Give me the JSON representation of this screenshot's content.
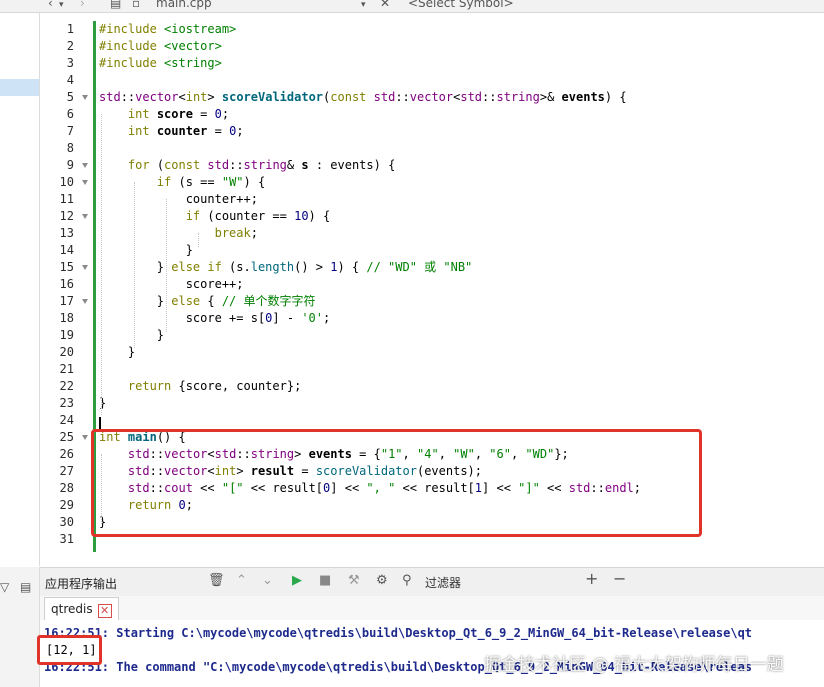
{
  "toolbar": {
    "file_name": "main.cpp",
    "symbol_select": "<Select Symbol>"
  },
  "editor": {
    "line_numbers": [
      "1",
      "2",
      "3",
      "4",
      "5",
      "6",
      "7",
      "8",
      "9",
      "10",
      "11",
      "12",
      "13",
      "14",
      "15",
      "16",
      "17",
      "18",
      "19",
      "20",
      "21",
      "22",
      "23",
      "24",
      "25",
      "26",
      "27",
      "28",
      "29",
      "30",
      "31"
    ],
    "lines": [
      [
        {
          "t": "#include ",
          "c": "kw"
        },
        {
          "t": "<iostream>",
          "c": "st"
        }
      ],
      [
        {
          "t": "#include ",
          "c": "kw"
        },
        {
          "t": "<vector>",
          "c": "st"
        }
      ],
      [
        {
          "t": "#include ",
          "c": "kw"
        },
        {
          "t": "<string>",
          "c": "st"
        }
      ],
      [],
      [
        {
          "t": "std",
          "c": "ty"
        },
        {
          "t": "::",
          "c": ""
        },
        {
          "t": "vector",
          "c": "ty"
        },
        {
          "t": "<",
          "c": ""
        },
        {
          "t": "int",
          "c": "kw"
        },
        {
          "t": "> ",
          "c": ""
        },
        {
          "t": "scoreValidator",
          "c": "fn b"
        },
        {
          "t": "(",
          "c": ""
        },
        {
          "t": "const ",
          "c": "kw"
        },
        {
          "t": "std",
          "c": "ty"
        },
        {
          "t": "::",
          "c": ""
        },
        {
          "t": "vector",
          "c": "ty"
        },
        {
          "t": "<",
          "c": ""
        },
        {
          "t": "std",
          "c": "ty"
        },
        {
          "t": "::",
          "c": ""
        },
        {
          "t": "string",
          "c": "ty"
        },
        {
          "t": ">& ",
          "c": ""
        },
        {
          "t": "events",
          "c": "b"
        },
        {
          "t": ") {",
          "c": ""
        }
      ],
      [
        {
          "t": "    ",
          "c": ""
        },
        {
          "t": "int ",
          "c": "kw"
        },
        {
          "t": "score",
          "c": "b"
        },
        {
          "t": " = ",
          "c": ""
        },
        {
          "t": "0",
          "c": "nm"
        },
        {
          "t": ";",
          "c": ""
        }
      ],
      [
        {
          "t": "    ",
          "c": ""
        },
        {
          "t": "int ",
          "c": "kw"
        },
        {
          "t": "counter",
          "c": "b"
        },
        {
          "t": " = ",
          "c": ""
        },
        {
          "t": "0",
          "c": "nm"
        },
        {
          "t": ";",
          "c": ""
        }
      ],
      [],
      [
        {
          "t": "    ",
          "c": ""
        },
        {
          "t": "for ",
          "c": "kw"
        },
        {
          "t": "(",
          "c": ""
        },
        {
          "t": "const ",
          "c": "kw"
        },
        {
          "t": "std",
          "c": "ty"
        },
        {
          "t": "::",
          "c": ""
        },
        {
          "t": "string",
          "c": "ty"
        },
        {
          "t": "& ",
          "c": ""
        },
        {
          "t": "s",
          "c": "b"
        },
        {
          "t": " : events) {",
          "c": ""
        }
      ],
      [
        {
          "t": "        ",
          "c": ""
        },
        {
          "t": "if ",
          "c": "kw"
        },
        {
          "t": "(s == ",
          "c": ""
        },
        {
          "t": "\"W\"",
          "c": "st"
        },
        {
          "t": ") {",
          "c": ""
        }
      ],
      [
        {
          "t": "            counter++;",
          "c": ""
        }
      ],
      [
        {
          "t": "            ",
          "c": ""
        },
        {
          "t": "if ",
          "c": "kw"
        },
        {
          "t": "(counter == ",
          "c": ""
        },
        {
          "t": "10",
          "c": "nm"
        },
        {
          "t": ") {",
          "c": ""
        }
      ],
      [
        {
          "t": "                ",
          "c": ""
        },
        {
          "t": "break",
          "c": "kw"
        },
        {
          "t": ";",
          "c": ""
        }
      ],
      [
        {
          "t": "            }",
          "c": ""
        }
      ],
      [
        {
          "t": "        } ",
          "c": ""
        },
        {
          "t": "else if ",
          "c": "kw"
        },
        {
          "t": "(s.",
          "c": ""
        },
        {
          "t": "length",
          "c": "fn"
        },
        {
          "t": "() > ",
          "c": ""
        },
        {
          "t": "1",
          "c": "nm"
        },
        {
          "t": ") { ",
          "c": ""
        },
        {
          "t": "// \"WD\" 或 \"NB\"",
          "c": "cm"
        }
      ],
      [
        {
          "t": "            score++;",
          "c": ""
        }
      ],
      [
        {
          "t": "        } ",
          "c": ""
        },
        {
          "t": "else ",
          "c": "kw"
        },
        {
          "t": "{ ",
          "c": ""
        },
        {
          "t": "// 单个数字字符",
          "c": "cm"
        }
      ],
      [
        {
          "t": "            score += s[",
          "c": ""
        },
        {
          "t": "0",
          "c": "nm"
        },
        {
          "t": "] - ",
          "c": ""
        },
        {
          "t": "'0'",
          "c": "st"
        },
        {
          "t": ";",
          "c": ""
        }
      ],
      [
        {
          "t": "        }",
          "c": ""
        }
      ],
      [
        {
          "t": "    }",
          "c": ""
        }
      ],
      [],
      [
        {
          "t": "    ",
          "c": ""
        },
        {
          "t": "return ",
          "c": "kw"
        },
        {
          "t": "{score, counter};",
          "c": ""
        }
      ],
      [
        {
          "t": "}",
          "c": ""
        }
      ],
      [],
      [
        {
          "t": "int ",
          "c": "kw"
        },
        {
          "t": "main",
          "c": "fn b"
        },
        {
          "t": "() {",
          "c": ""
        }
      ],
      [
        {
          "t": "    ",
          "c": ""
        },
        {
          "t": "std",
          "c": "ty"
        },
        {
          "t": "::",
          "c": ""
        },
        {
          "t": "vector",
          "c": "ty"
        },
        {
          "t": "<",
          "c": ""
        },
        {
          "t": "std",
          "c": "ty"
        },
        {
          "t": "::",
          "c": ""
        },
        {
          "t": "string",
          "c": "ty"
        },
        {
          "t": "> ",
          "c": ""
        },
        {
          "t": "events",
          "c": "b"
        },
        {
          "t": " = {",
          "c": ""
        },
        {
          "t": "\"1\"",
          "c": "st"
        },
        {
          "t": ", ",
          "c": ""
        },
        {
          "t": "\"4\"",
          "c": "st"
        },
        {
          "t": ", ",
          "c": ""
        },
        {
          "t": "\"W\"",
          "c": "st"
        },
        {
          "t": ", ",
          "c": ""
        },
        {
          "t": "\"6\"",
          "c": "st"
        },
        {
          "t": ", ",
          "c": ""
        },
        {
          "t": "\"WD\"",
          "c": "st"
        },
        {
          "t": "};",
          "c": ""
        }
      ],
      [
        {
          "t": "    ",
          "c": ""
        },
        {
          "t": "std",
          "c": "ty"
        },
        {
          "t": "::",
          "c": ""
        },
        {
          "t": "vector",
          "c": "ty"
        },
        {
          "t": "<",
          "c": ""
        },
        {
          "t": "int",
          "c": "kw"
        },
        {
          "t": "> ",
          "c": ""
        },
        {
          "t": "result",
          "c": "b"
        },
        {
          "t": " = ",
          "c": ""
        },
        {
          "t": "scoreValidator",
          "c": "fn"
        },
        {
          "t": "(events);",
          "c": ""
        }
      ],
      [
        {
          "t": "    ",
          "c": ""
        },
        {
          "t": "std",
          "c": "ty"
        },
        {
          "t": "::",
          "c": ""
        },
        {
          "t": "cout",
          "c": "ty"
        },
        {
          "t": " << ",
          "c": ""
        },
        {
          "t": "\"[\"",
          "c": "st"
        },
        {
          "t": " << result[",
          "c": ""
        },
        {
          "t": "0",
          "c": "nm"
        },
        {
          "t": "] << ",
          "c": ""
        },
        {
          "t": "\", \"",
          "c": "st"
        },
        {
          "t": " << result[",
          "c": ""
        },
        {
          "t": "1",
          "c": "nm"
        },
        {
          "t": "] << ",
          "c": ""
        },
        {
          "t": "\"]\"",
          "c": "st"
        },
        {
          "t": " << ",
          "c": ""
        },
        {
          "t": "std",
          "c": "ty"
        },
        {
          "t": "::",
          "c": ""
        },
        {
          "t": "endl",
          "c": "ty"
        },
        {
          "t": ";",
          "c": ""
        }
      ],
      [
        {
          "t": "    ",
          "c": ""
        },
        {
          "t": "return ",
          "c": "kw"
        },
        {
          "t": "0",
          "c": "nm"
        },
        {
          "t": ";",
          "c": ""
        }
      ],
      [
        {
          "t": "}",
          "c": ""
        }
      ],
      []
    ],
    "fold_lines": [
      5,
      9,
      10,
      12,
      15,
      17,
      25
    ]
  },
  "output": {
    "pane_title": "应用程序输出",
    "filter_label": "过滤器",
    "tab_label": "qtredis",
    "tab_close": "✕",
    "lines": [
      "16:22:51: Starting C:\\mycode\\mycode\\qtredis\\build\\Desktop_Qt_6_9_2_MinGW_64_bit-Release\\release\\qt",
      "16:22:51: The command \"C:\\mycode\\mycode\\qtredis\\build\\Desktop_Qt_6_9_2_MinGW_64_bit-Release\\releas"
    ],
    "result": "[12, 1]"
  },
  "watermark": "掘金技术社区 @ 福大大架构师每日一题",
  "colors": {
    "highlight_box": "#e0342b",
    "change_bar": "#2e9d3f",
    "run_button": "#2aa84a"
  }
}
